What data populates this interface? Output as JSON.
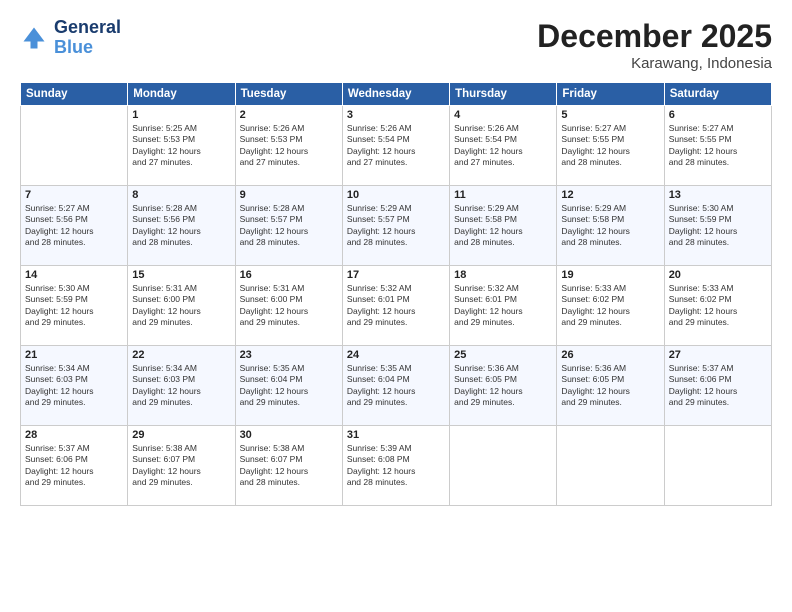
{
  "header": {
    "logo_line1": "General",
    "logo_line2": "Blue",
    "title": "December 2025",
    "subtitle": "Karawang, Indonesia"
  },
  "days_of_week": [
    "Sunday",
    "Monday",
    "Tuesday",
    "Wednesday",
    "Thursday",
    "Friday",
    "Saturday"
  ],
  "weeks": [
    [
      {
        "day": "",
        "text": ""
      },
      {
        "day": "1",
        "text": "Sunrise: 5:25 AM\nSunset: 5:53 PM\nDaylight: 12 hours\nand 27 minutes."
      },
      {
        "day": "2",
        "text": "Sunrise: 5:26 AM\nSunset: 5:53 PM\nDaylight: 12 hours\nand 27 minutes."
      },
      {
        "day": "3",
        "text": "Sunrise: 5:26 AM\nSunset: 5:54 PM\nDaylight: 12 hours\nand 27 minutes."
      },
      {
        "day": "4",
        "text": "Sunrise: 5:26 AM\nSunset: 5:54 PM\nDaylight: 12 hours\nand 27 minutes."
      },
      {
        "day": "5",
        "text": "Sunrise: 5:27 AM\nSunset: 5:55 PM\nDaylight: 12 hours\nand 28 minutes."
      },
      {
        "day": "6",
        "text": "Sunrise: 5:27 AM\nSunset: 5:55 PM\nDaylight: 12 hours\nand 28 minutes."
      }
    ],
    [
      {
        "day": "7",
        "text": "Sunrise: 5:27 AM\nSunset: 5:56 PM\nDaylight: 12 hours\nand 28 minutes."
      },
      {
        "day": "8",
        "text": "Sunrise: 5:28 AM\nSunset: 5:56 PM\nDaylight: 12 hours\nand 28 minutes."
      },
      {
        "day": "9",
        "text": "Sunrise: 5:28 AM\nSunset: 5:57 PM\nDaylight: 12 hours\nand 28 minutes."
      },
      {
        "day": "10",
        "text": "Sunrise: 5:29 AM\nSunset: 5:57 PM\nDaylight: 12 hours\nand 28 minutes."
      },
      {
        "day": "11",
        "text": "Sunrise: 5:29 AM\nSunset: 5:58 PM\nDaylight: 12 hours\nand 28 minutes."
      },
      {
        "day": "12",
        "text": "Sunrise: 5:29 AM\nSunset: 5:58 PM\nDaylight: 12 hours\nand 28 minutes."
      },
      {
        "day": "13",
        "text": "Sunrise: 5:30 AM\nSunset: 5:59 PM\nDaylight: 12 hours\nand 28 minutes."
      }
    ],
    [
      {
        "day": "14",
        "text": "Sunrise: 5:30 AM\nSunset: 5:59 PM\nDaylight: 12 hours\nand 29 minutes."
      },
      {
        "day": "15",
        "text": "Sunrise: 5:31 AM\nSunset: 6:00 PM\nDaylight: 12 hours\nand 29 minutes."
      },
      {
        "day": "16",
        "text": "Sunrise: 5:31 AM\nSunset: 6:00 PM\nDaylight: 12 hours\nand 29 minutes."
      },
      {
        "day": "17",
        "text": "Sunrise: 5:32 AM\nSunset: 6:01 PM\nDaylight: 12 hours\nand 29 minutes."
      },
      {
        "day": "18",
        "text": "Sunrise: 5:32 AM\nSunset: 6:01 PM\nDaylight: 12 hours\nand 29 minutes."
      },
      {
        "day": "19",
        "text": "Sunrise: 5:33 AM\nSunset: 6:02 PM\nDaylight: 12 hours\nand 29 minutes."
      },
      {
        "day": "20",
        "text": "Sunrise: 5:33 AM\nSunset: 6:02 PM\nDaylight: 12 hours\nand 29 minutes."
      }
    ],
    [
      {
        "day": "21",
        "text": "Sunrise: 5:34 AM\nSunset: 6:03 PM\nDaylight: 12 hours\nand 29 minutes."
      },
      {
        "day": "22",
        "text": "Sunrise: 5:34 AM\nSunset: 6:03 PM\nDaylight: 12 hours\nand 29 minutes."
      },
      {
        "day": "23",
        "text": "Sunrise: 5:35 AM\nSunset: 6:04 PM\nDaylight: 12 hours\nand 29 minutes."
      },
      {
        "day": "24",
        "text": "Sunrise: 5:35 AM\nSunset: 6:04 PM\nDaylight: 12 hours\nand 29 minutes."
      },
      {
        "day": "25",
        "text": "Sunrise: 5:36 AM\nSunset: 6:05 PM\nDaylight: 12 hours\nand 29 minutes."
      },
      {
        "day": "26",
        "text": "Sunrise: 5:36 AM\nSunset: 6:05 PM\nDaylight: 12 hours\nand 29 minutes."
      },
      {
        "day": "27",
        "text": "Sunrise: 5:37 AM\nSunset: 6:06 PM\nDaylight: 12 hours\nand 29 minutes."
      }
    ],
    [
      {
        "day": "28",
        "text": "Sunrise: 5:37 AM\nSunset: 6:06 PM\nDaylight: 12 hours\nand 29 minutes."
      },
      {
        "day": "29",
        "text": "Sunrise: 5:38 AM\nSunset: 6:07 PM\nDaylight: 12 hours\nand 29 minutes."
      },
      {
        "day": "30",
        "text": "Sunrise: 5:38 AM\nSunset: 6:07 PM\nDaylight: 12 hours\nand 28 minutes."
      },
      {
        "day": "31",
        "text": "Sunrise: 5:39 AM\nSunset: 6:08 PM\nDaylight: 12 hours\nand 28 minutes."
      },
      {
        "day": "",
        "text": ""
      },
      {
        "day": "",
        "text": ""
      },
      {
        "day": "",
        "text": ""
      }
    ]
  ]
}
